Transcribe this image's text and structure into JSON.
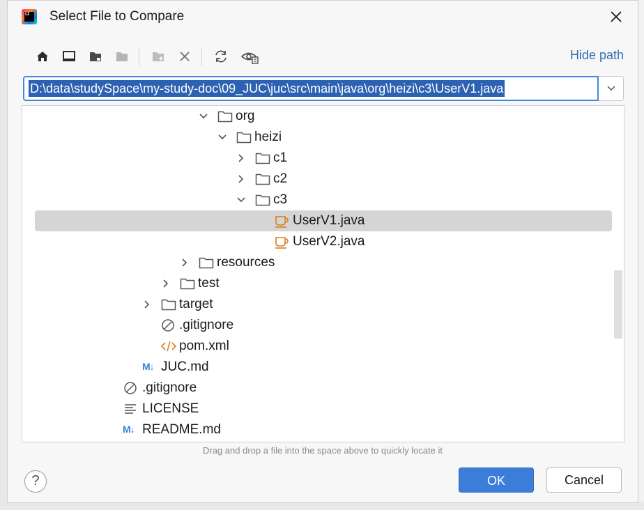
{
  "window": {
    "title": "Select File to Compare"
  },
  "toolbar": {
    "icons": [
      "home-icon",
      "desktop-icon",
      "project-folder-icon",
      "module-folder-icon",
      "new-folder-icon",
      "delete-icon",
      "refresh-icon",
      "show-hidden-icon"
    ],
    "hide_path_label": "Hide path"
  },
  "path": {
    "value": "D:\\data\\studySpace\\my-study-doc\\09_JUC\\juc\\src\\main\\java\\org\\heizi\\c3\\UserV1.java"
  },
  "tree": {
    "rows": [
      {
        "label": "org",
        "type": "folder",
        "expanded": true
      },
      {
        "label": "heizi",
        "type": "folder",
        "expanded": true
      },
      {
        "label": "c1",
        "type": "folder",
        "expanded": false
      },
      {
        "label": "c2",
        "type": "folder",
        "expanded": false
      },
      {
        "label": "c3",
        "type": "folder",
        "expanded": true
      },
      {
        "label": "UserV1.java",
        "type": "java",
        "selected": true
      },
      {
        "label": "UserV2.java",
        "type": "java"
      },
      {
        "label": "resources",
        "type": "folder",
        "expanded": false
      },
      {
        "label": "test",
        "type": "folder",
        "expanded": false
      },
      {
        "label": "target",
        "type": "folder",
        "expanded": false
      },
      {
        "label": ".gitignore",
        "type": "ignore"
      },
      {
        "label": "pom.xml",
        "type": "xml"
      },
      {
        "label": "JUC.md",
        "type": "markdown"
      },
      {
        "label": ".gitignore",
        "type": "ignore"
      },
      {
        "label": "LICENSE",
        "type": "text"
      },
      {
        "label": "README.md",
        "type": "markdown"
      }
    ]
  },
  "footer": {
    "hint": "Drag and drop a file into the space above to quickly locate it",
    "help_label": "?",
    "ok_label": "OK",
    "cancel_label": "Cancel"
  },
  "colors": {
    "accent": "#3b7dd8",
    "selection": "#d5d5d5",
    "java_icon": "#e07a20",
    "link": "#2f6fb3"
  }
}
